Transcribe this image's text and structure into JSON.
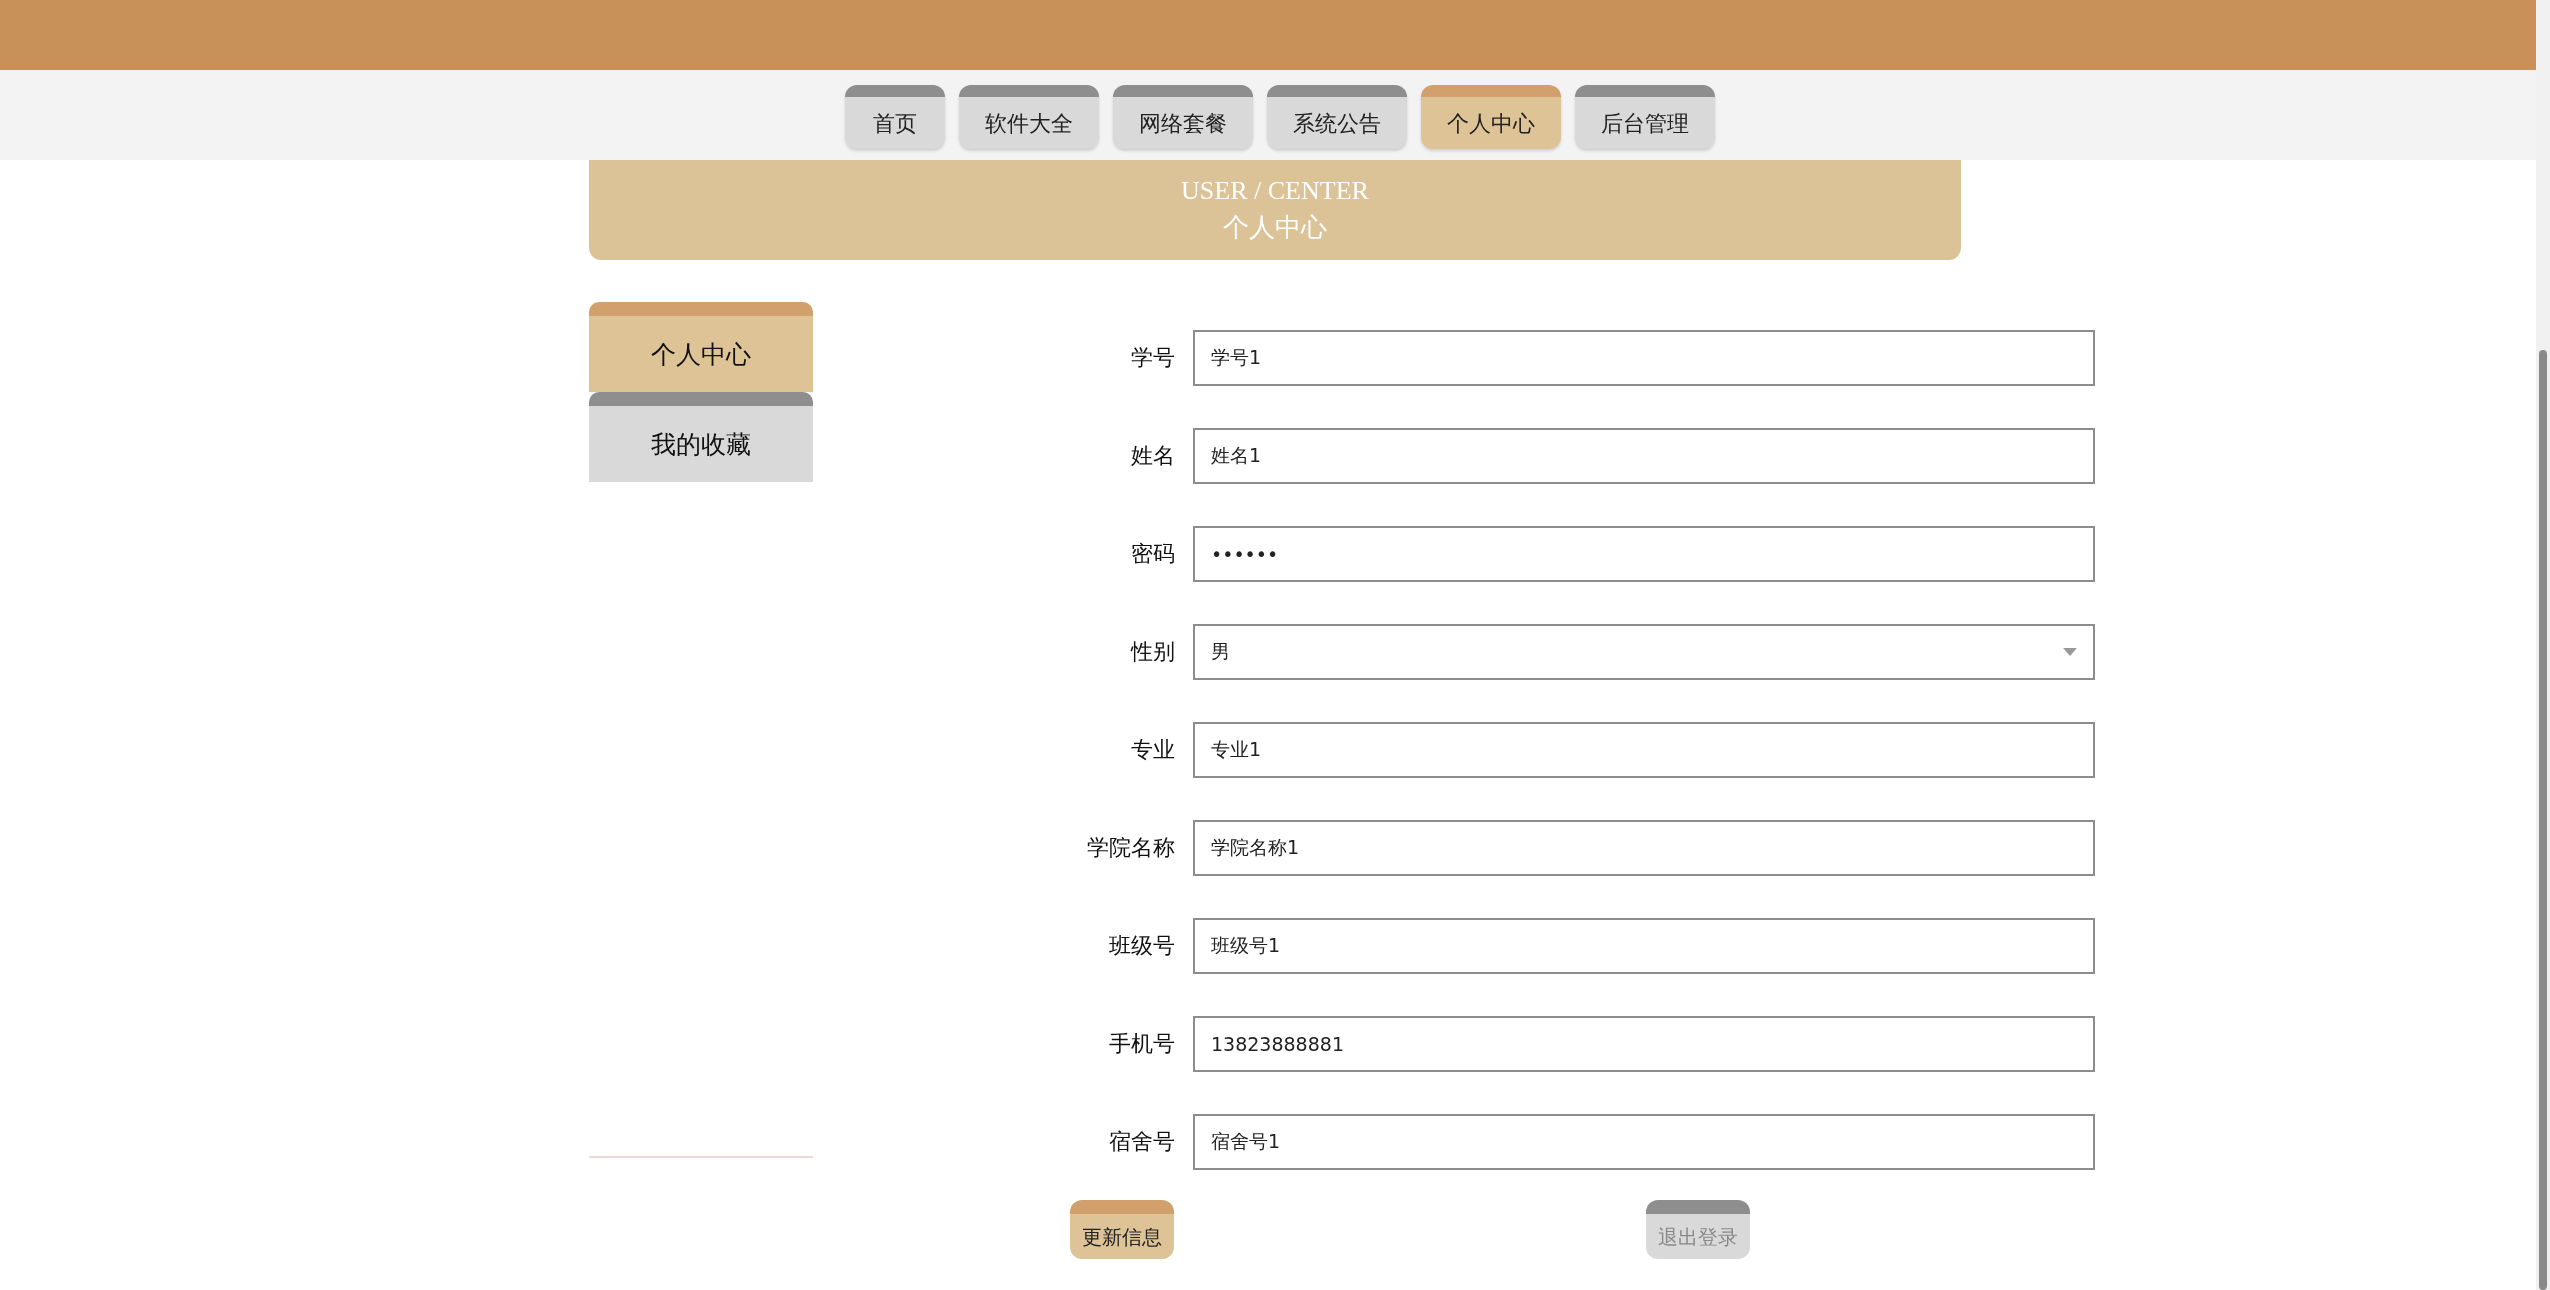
{
  "nav": [
    {
      "label": "首页",
      "selected": false
    },
    {
      "label": "软件大全",
      "selected": false
    },
    {
      "label": "网络套餐",
      "selected": false
    },
    {
      "label": "系统公告",
      "selected": false
    },
    {
      "label": "个人中心",
      "selected": true
    },
    {
      "label": "后台管理",
      "selected": false
    }
  ],
  "banner": {
    "title": "USER / CENTER",
    "subtitle": "个人中心"
  },
  "sidebar": [
    {
      "label": "个人中心",
      "selected": true
    },
    {
      "label": "我的收藏",
      "selected": false
    }
  ],
  "form": [
    {
      "label": "学号",
      "kind": "text",
      "value": "学号1"
    },
    {
      "label": "姓名",
      "kind": "text",
      "value": "姓名1"
    },
    {
      "label": "密码",
      "kind": "password",
      "value": "••••••"
    },
    {
      "label": "性别",
      "kind": "select",
      "value": "男"
    },
    {
      "label": "专业",
      "kind": "text",
      "value": "专业1"
    },
    {
      "label": "学院名称",
      "kind": "text",
      "value": "学院名称1"
    },
    {
      "label": "班级号",
      "kind": "text",
      "value": "班级号1"
    },
    {
      "label": "手机号",
      "kind": "text",
      "value": "13823888881"
    },
    {
      "label": "宿舍号",
      "kind": "text",
      "value": "宿舍号1"
    }
  ],
  "buttons": [
    {
      "label": "更新信息",
      "disabled": false
    },
    {
      "label": "退出登录",
      "disabled": true
    }
  ]
}
